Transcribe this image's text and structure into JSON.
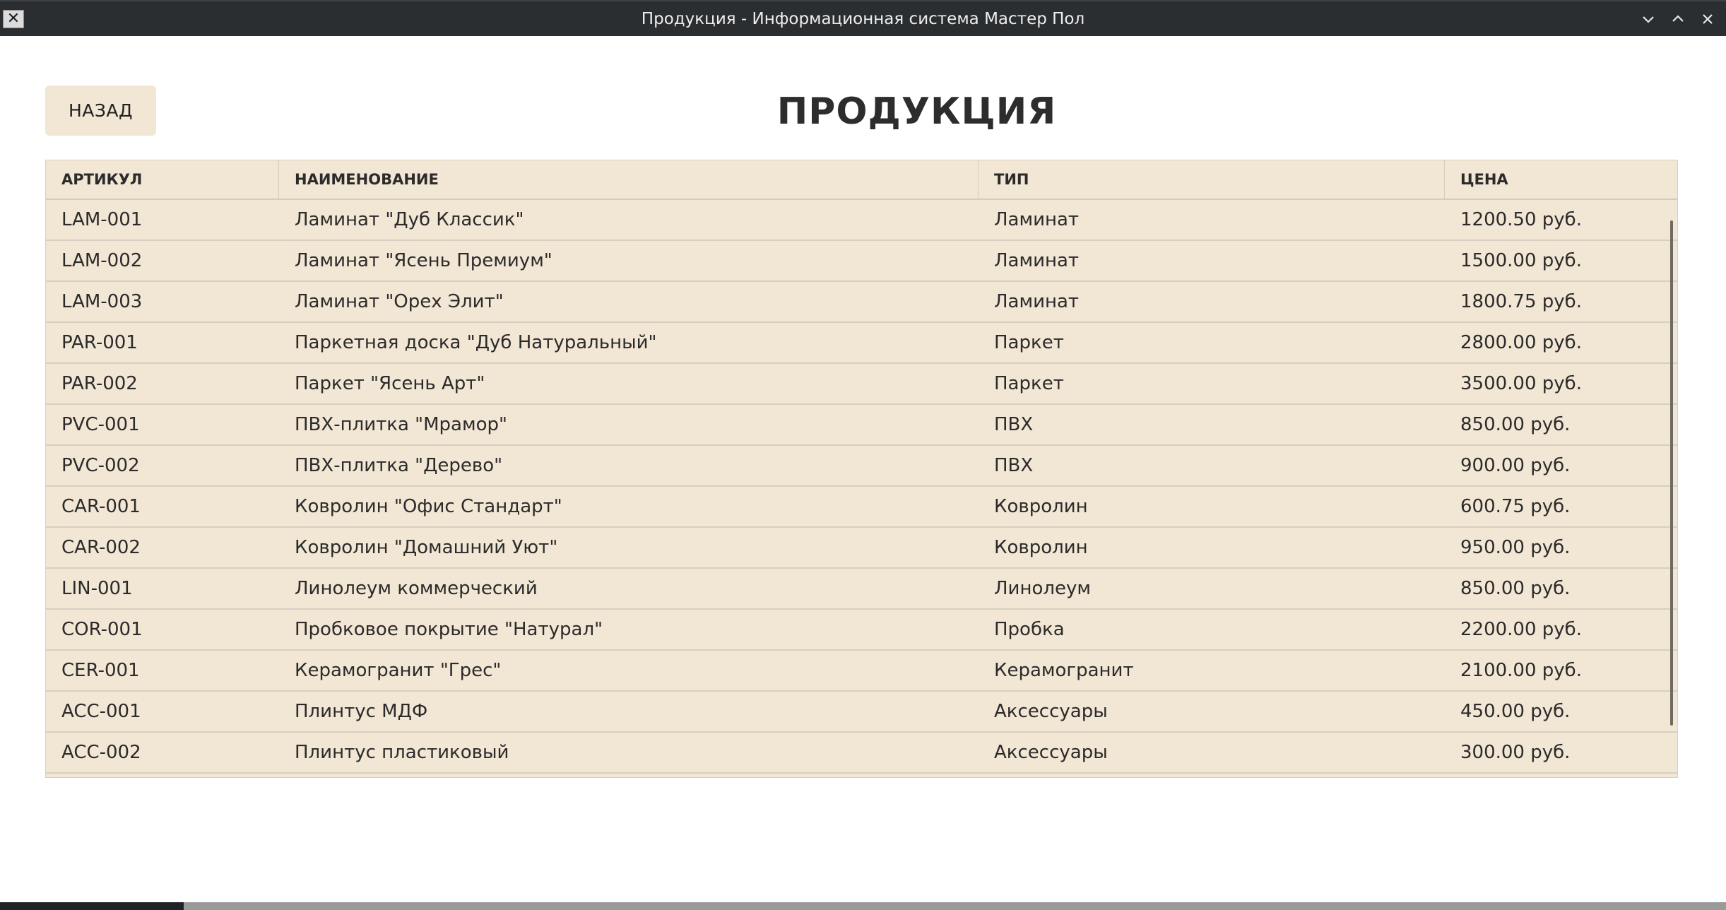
{
  "window": {
    "title": "Продукция - Информационная система Мастер Пол",
    "app_icon": "x11-icon",
    "controls": [
      "minimize-icon",
      "maximize-icon",
      "close-icon"
    ]
  },
  "toolbar": {
    "back_label": "НАЗАД"
  },
  "page": {
    "title": "ПРОДУКЦИЯ"
  },
  "table": {
    "columns": [
      "АРТИКУЛ",
      "НАИМЕНОВАНИЕ",
      "ТИП",
      "ЦЕНА"
    ],
    "rows": [
      [
        "LAM-001",
        "Ламинат \"Дуб Классик\"",
        "Ламинат",
        "1200.50 руб."
      ],
      [
        "LAM-002",
        "Ламинат \"Ясень Премиум\"",
        "Ламинат",
        "1500.00 руб."
      ],
      [
        "LAM-003",
        "Ламинат \"Орех Элит\"",
        "Ламинат",
        "1800.75 руб."
      ],
      [
        "PAR-001",
        "Паркетная доска \"Дуб Натуральный\"",
        "Паркет",
        "2800.00 руб."
      ],
      [
        "PAR-002",
        "Паркет \"Ясень Арт\"",
        "Паркет",
        "3500.00 руб."
      ],
      [
        "PVC-001",
        "ПВХ-плитка \"Мрамор\"",
        "ПВХ",
        "850.00 руб."
      ],
      [
        "PVC-002",
        "ПВХ-плитка \"Дерево\"",
        "ПВХ",
        "900.00 руб."
      ],
      [
        "CAR-001",
        "Ковролин \"Офис Стандарт\"",
        "Ковролин",
        "600.75 руб."
      ],
      [
        "CAR-002",
        "Ковролин \"Домашний Уют\"",
        "Ковролин",
        "950.00 руб."
      ],
      [
        "LIN-001",
        "Линолеум коммерческий",
        "Линолеум",
        "850.00 руб."
      ],
      [
        "COR-001",
        "Пробковое покрытие \"Натурал\"",
        "Пробка",
        "2200.00 руб."
      ],
      [
        "CER-001",
        "Керамогранит \"Грес\"",
        "Керамогранит",
        "2100.00 руб."
      ],
      [
        "ACC-001",
        "Плинтус МДФ",
        "Аксессуары",
        "450.00 руб."
      ],
      [
        "ACC-002",
        "Плинтус пластиковый",
        "Аксессуары",
        "300.00 руб."
      ]
    ]
  },
  "colors": {
    "titlebar": "#2b2e31",
    "accent_beige": "#f2e6d4",
    "text": "#2b2b2b"
  }
}
